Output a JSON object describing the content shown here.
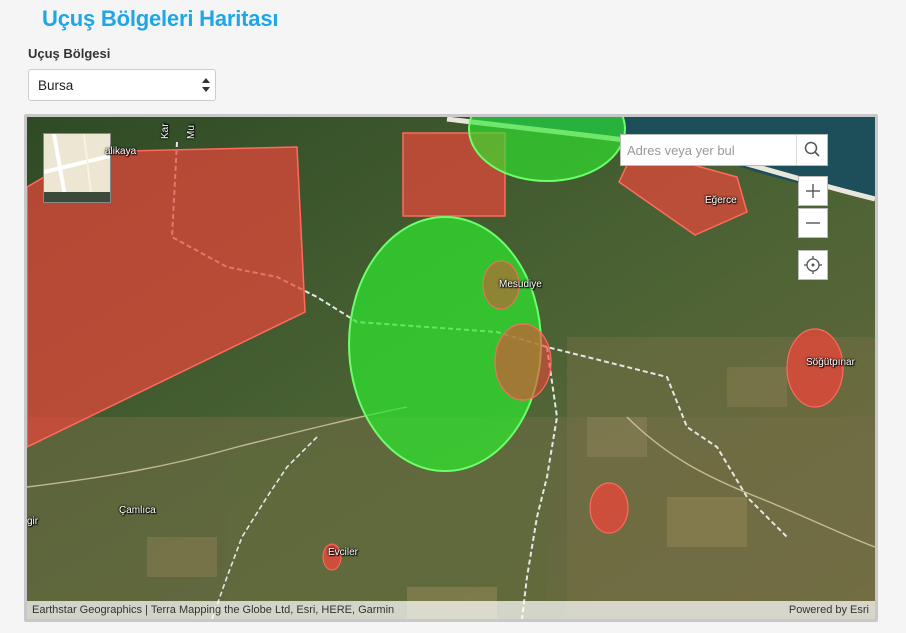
{
  "page": {
    "title": "Uçuş Bölgeleri Haritası",
    "region_label": "Uçuş Bölgesi",
    "region_selected": "Bursa"
  },
  "map": {
    "search_placeholder": "Adres veya yer bul",
    "zoom_in": "+",
    "zoom_out": "−",
    "attribution_left": "Earthstar Geographics | Terra Mapping the Globe Ltd, Esri, HERE, Garmin",
    "attribution_right": "Powered by Esri",
    "labels": {
      "alikaya": "alikaya",
      "mesudiye": "Mesudiye",
      "egerce": "Eğerce",
      "sogutpinar": "Söğütpınar",
      "camlica": "Çamlıca",
      "evciler": "Evciler",
      "gir": "gir",
      "kar": "Kar",
      "mu": "Mu"
    },
    "colors": {
      "restricted": "#e8473a",
      "allowed": "#2ee82e",
      "title": "#1ea6e6"
    }
  }
}
